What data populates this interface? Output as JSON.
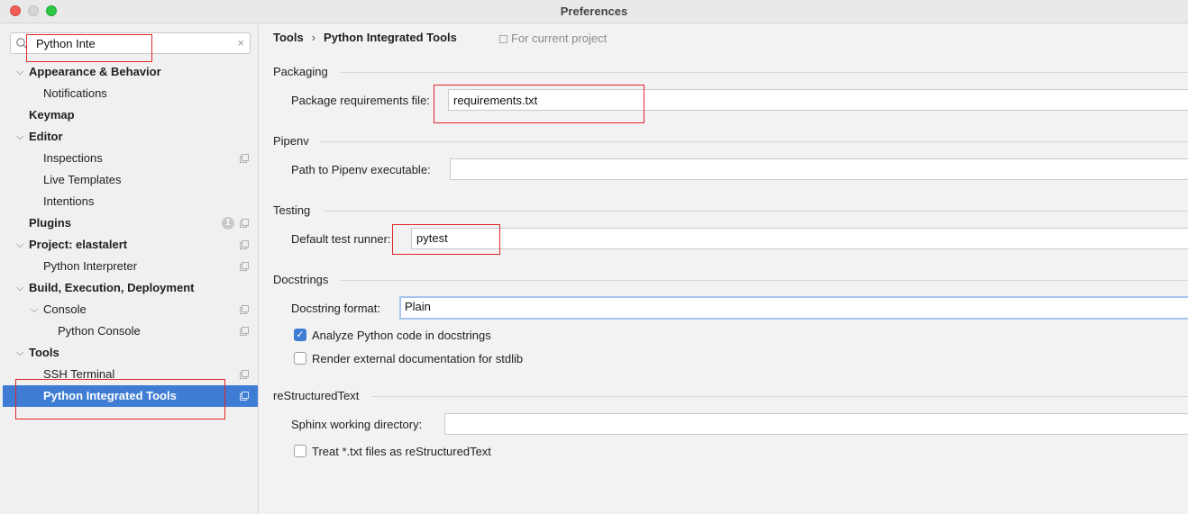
{
  "window": {
    "title": "Preferences"
  },
  "search": {
    "value": "Python Inte",
    "clear": "×"
  },
  "tree": [
    {
      "label": "Appearance & Behavior",
      "expanded": true
    },
    {
      "label": "Notifications"
    },
    {
      "label": "Keymap"
    },
    {
      "label": "Editor",
      "expanded": true
    },
    {
      "label": "Inspections"
    },
    {
      "label": "Live Templates"
    },
    {
      "label": "Intentions"
    },
    {
      "label": "Plugins",
      "badge": "1"
    },
    {
      "label": "Project: elastalert",
      "expanded": true
    },
    {
      "label": "Python Interpreter"
    },
    {
      "label": "Build, Execution, Deployment",
      "expanded": true
    },
    {
      "label": "Console",
      "expanded": true
    },
    {
      "label": "Python Console"
    },
    {
      "label": "Tools",
      "expanded": true
    },
    {
      "label": "SSH Terminal"
    },
    {
      "label": "Python Integrated Tools",
      "selected": true
    }
  ],
  "breadcrumb": {
    "parent": "Tools",
    "separator": "›",
    "current": "Python Integrated Tools"
  },
  "scope": "For current project",
  "packaging": {
    "title": "Packaging",
    "req_label": "Package requirements file:",
    "req_value": "requirements.txt"
  },
  "pipenv": {
    "title": "Pipenv",
    "path_label": "Path to Pipenv executable:",
    "path_value": ""
  },
  "testing": {
    "title": "Testing",
    "runner_label": "Default test runner:",
    "runner_value": "pytest"
  },
  "docstrings": {
    "title": "Docstrings",
    "format_label": "Docstring format:",
    "format_value": "Plain",
    "analyze_label": "Analyze Python code in docstrings",
    "analyze_checked": true,
    "render_label": "Render external documentation for stdlib",
    "render_checked": false
  },
  "rest": {
    "title": "reStructuredText",
    "sphinx_label": "Sphinx working directory:",
    "sphinx_value": "",
    "treat_label": "Treat *.txt files as reStructuredText",
    "treat_checked": false
  },
  "colors": {
    "selection": "#3f7cd4",
    "annotation": "#e0272b"
  }
}
